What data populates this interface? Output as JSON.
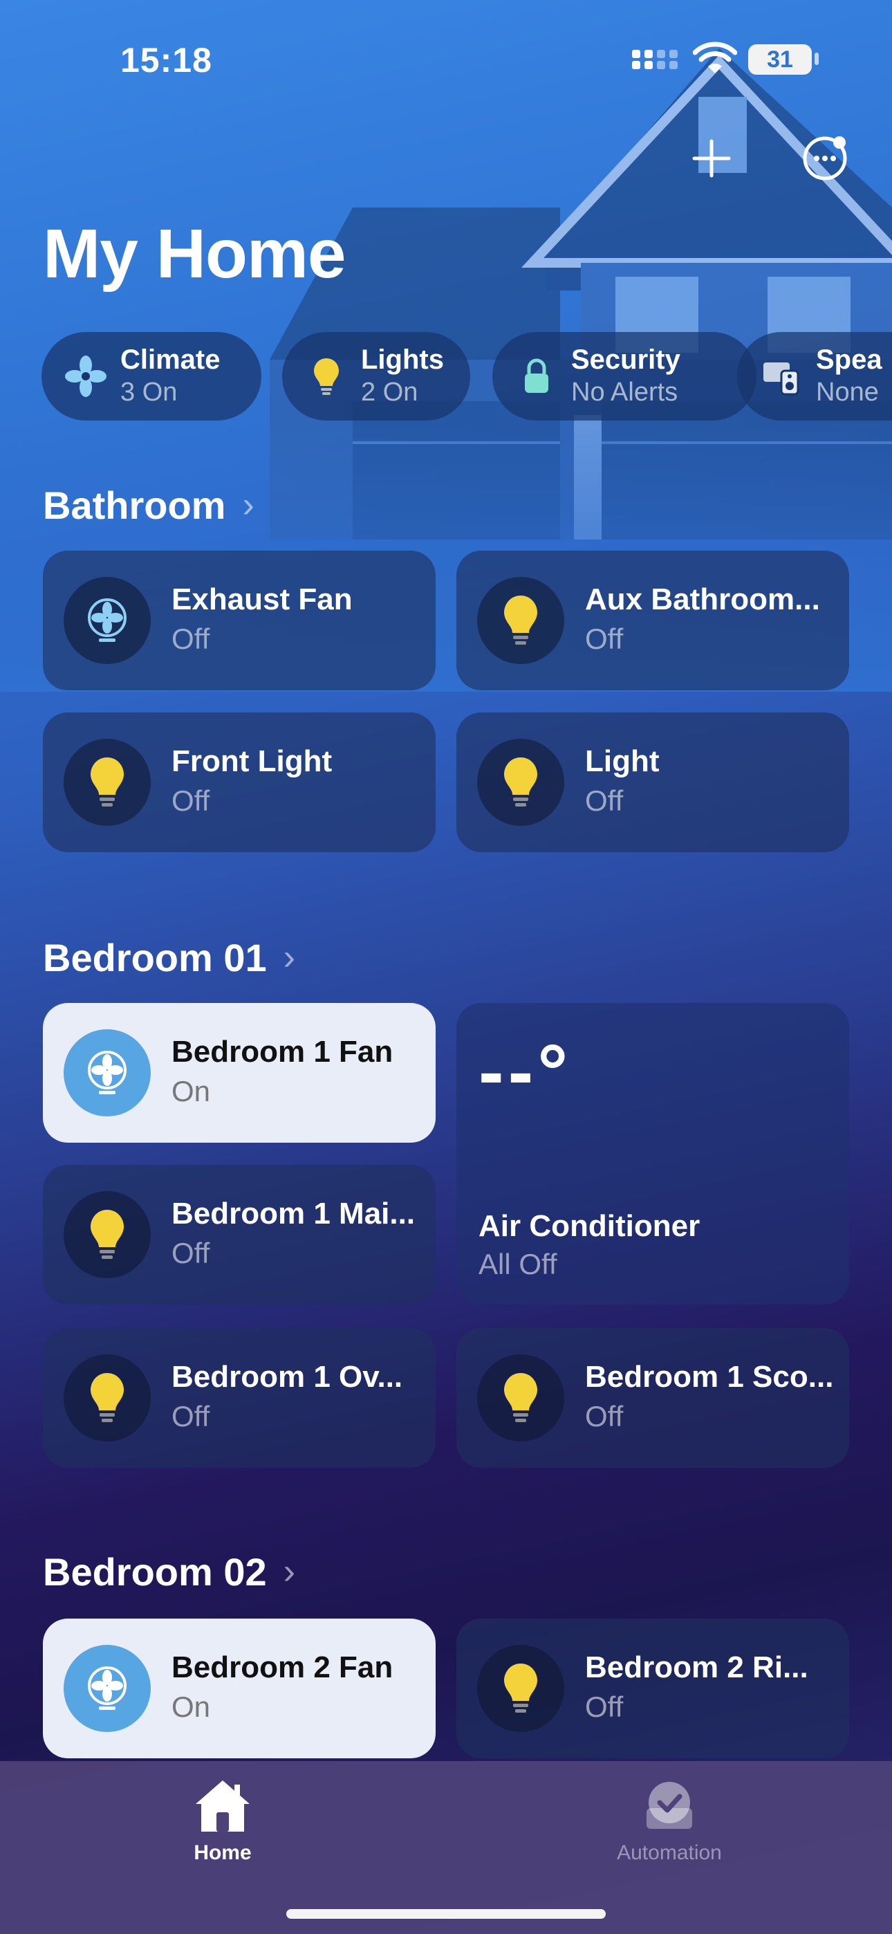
{
  "status_bar": {
    "time": "15:18",
    "battery": "31"
  },
  "header": {
    "title": "My Home"
  },
  "chips": [
    {
      "title": "Climate",
      "subtitle": "3 On",
      "icon": "fan-icon"
    },
    {
      "title": "Lights",
      "subtitle": "2 On",
      "icon": "lightbulb-icon"
    },
    {
      "title": "Security",
      "subtitle": "No Alerts",
      "icon": "lock-icon"
    },
    {
      "title": "Spea",
      "subtitle": "None",
      "icon": "speaker-icon"
    }
  ],
  "sections": [
    {
      "title": "Bathroom",
      "tiles": [
        {
          "name": "Exhaust Fan",
          "state": "Off",
          "icon": "fan-icon"
        },
        {
          "name": "Aux Bathroom...",
          "state": "Off",
          "icon": "lightbulb-icon"
        },
        {
          "name": "Front Light",
          "state": "Off",
          "icon": "lightbulb-icon"
        },
        {
          "name": "Light",
          "state": "Off",
          "icon": "lightbulb-icon"
        }
      ]
    },
    {
      "title": "Bedroom 01",
      "tiles": [
        {
          "name": "Bedroom 1 Fan",
          "state": "On",
          "icon": "fan-icon"
        },
        {
          "name": "Bedroom 1 Mai...",
          "state": "Off",
          "icon": "lightbulb-icon"
        },
        {
          "name": "Bedroom 1 Ov...",
          "state": "Off",
          "icon": "lightbulb-icon"
        },
        {
          "name": "Bedroom 1 Sco...",
          "state": "Off",
          "icon": "lightbulb-icon"
        }
      ],
      "ac": {
        "temperature": "--°",
        "name": "Air Conditioner",
        "state": "All Off"
      }
    },
    {
      "title": "Bedroom 02",
      "tiles": [
        {
          "name": "Bedroom 2 Fan",
          "state": "On",
          "icon": "fan-icon"
        },
        {
          "name": "Bedroom 2  Ri...",
          "state": "Off",
          "icon": "lightbulb-icon"
        }
      ]
    }
  ],
  "tab_bar": {
    "home_label": "Home",
    "automation_label": "Automation"
  },
  "colors": {
    "accent_blue": "#57a6e3",
    "bulb_yellow": "#f3d23a",
    "lock_mint": "#7fe0d2"
  }
}
